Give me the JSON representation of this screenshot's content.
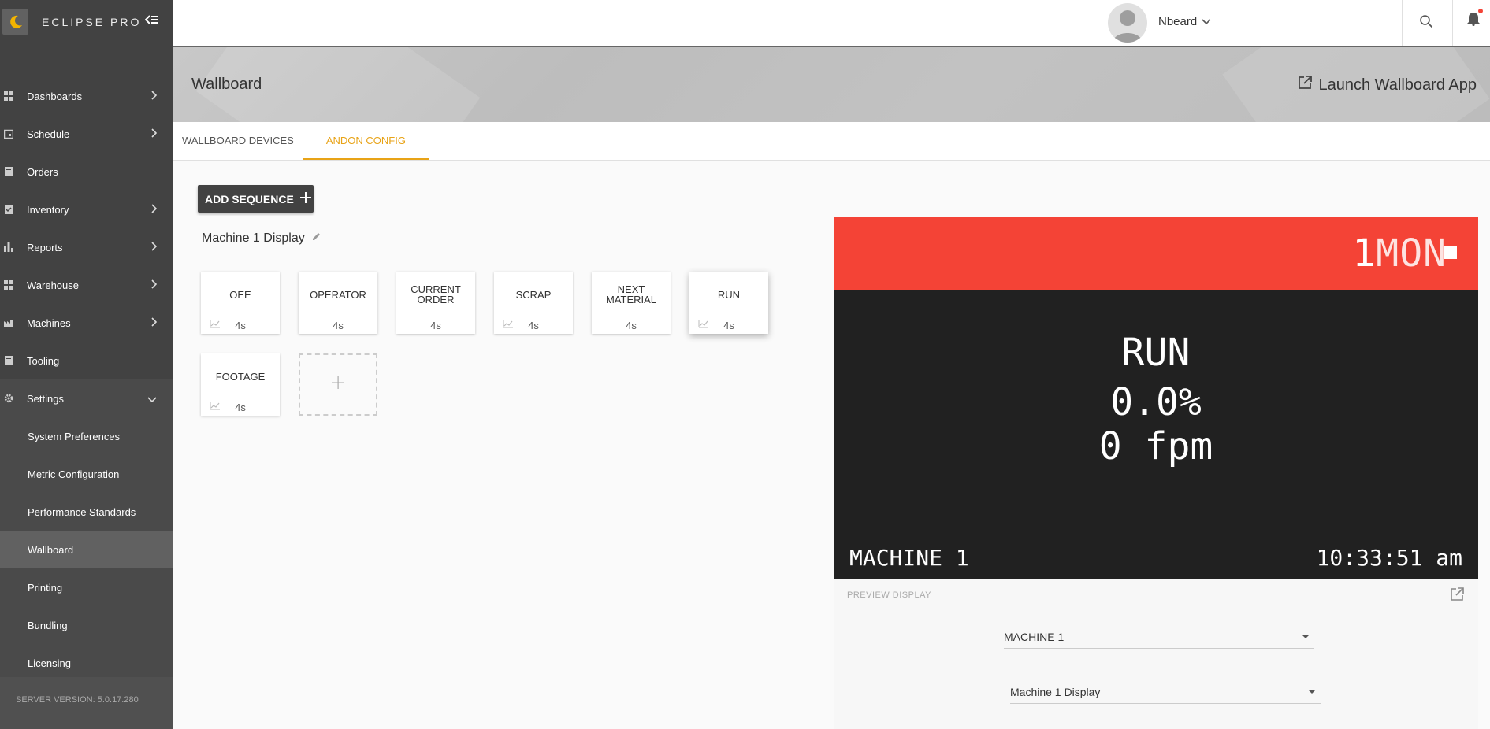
{
  "app": {
    "brand": "ECLIPSE PRO",
    "server_version": "SERVER VERSION: 5.0.17.280"
  },
  "sidebar": {
    "items": [
      {
        "label": "Dashboards"
      },
      {
        "label": "Schedule"
      },
      {
        "label": "Orders"
      },
      {
        "label": "Inventory"
      },
      {
        "label": "Reports"
      },
      {
        "label": "Warehouse"
      },
      {
        "label": "Machines"
      },
      {
        "label": "Tooling"
      },
      {
        "label": "Settings"
      }
    ],
    "settings_sub": [
      {
        "label": "System Preferences"
      },
      {
        "label": "Metric Configuration"
      },
      {
        "label": "Performance Standards"
      },
      {
        "label": "Wallboard"
      },
      {
        "label": "Printing"
      },
      {
        "label": "Bundling"
      },
      {
        "label": "Licensing"
      }
    ]
  },
  "topbar": {
    "username": "Nbeard"
  },
  "banner": {
    "title": "Wallboard",
    "launch_label": "Launch Wallboard App"
  },
  "tabs": [
    {
      "label": "WALLBOARD DEVICES"
    },
    {
      "label": "ANDON CONFIG"
    }
  ],
  "content": {
    "add_sequence_label": "ADD SEQUENCE",
    "display_name": "Machine 1 Display",
    "cards": [
      {
        "label": "OEE",
        "duration": "4s"
      },
      {
        "label": "OPERATOR",
        "duration": "4s"
      },
      {
        "label": "CURRENT ORDER",
        "duration": "4s"
      },
      {
        "label": "SCRAP",
        "duration": "4s"
      },
      {
        "label": "NEXT MATERIAL",
        "duration": "4s"
      },
      {
        "label": "RUN",
        "duration": "4s"
      },
      {
        "label": "FOOTAGE",
        "duration": "4s"
      }
    ]
  },
  "preview": {
    "top_number": "1",
    "top_day": "MON",
    "status": "RUN",
    "percent": "0.0%",
    "speed": "0 fpm",
    "machine": "MACHINE 1",
    "time": "10:33:51 am",
    "footer_label": "PREVIEW DISPLAY",
    "machine_select": "MACHINE 1",
    "display_select": "Machine 1 Display"
  },
  "colors": {
    "accent": "#e8a317",
    "alert_red": "#f44336",
    "sidebar": "#424242",
    "display_bg": "#212121"
  }
}
